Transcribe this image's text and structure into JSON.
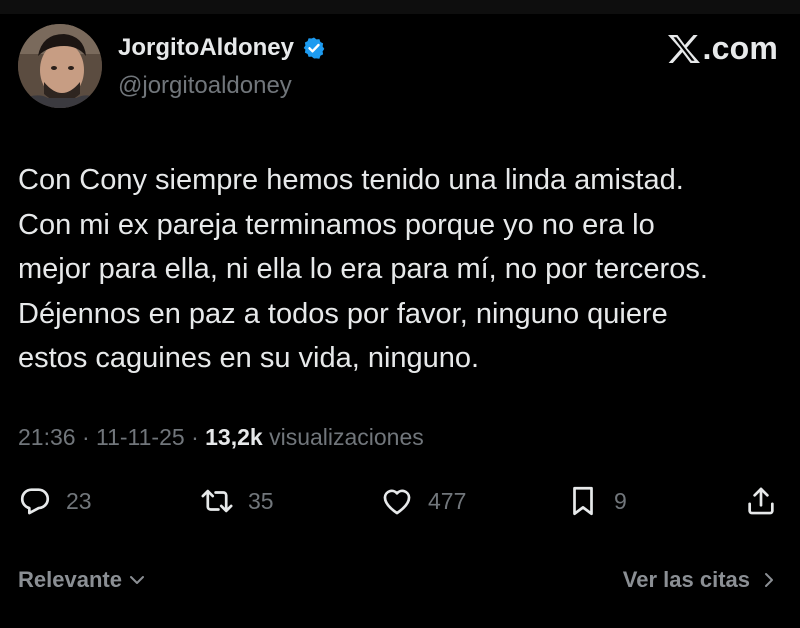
{
  "author": {
    "display_name": "JorgitoAldoney",
    "handle": "@jorgitoaldoney",
    "verified": true
  },
  "brand": {
    "text": ".com"
  },
  "tweet": {
    "lines": [
      "Con Cony siempre hemos tenido una linda amistad.",
      "Con mi ex pareja terminamos porque yo no era lo",
      "mejor para ella, ni ella lo era para mí, no por terceros.",
      "Déjennos en paz a todos por favor, ninguno quiere",
      "estos caguines en su vida, ninguno."
    ]
  },
  "meta": {
    "time": "21:36",
    "separator": "·",
    "date": "11-11-25",
    "views": "13,2k",
    "views_label": "visualizaciones"
  },
  "actions": {
    "replies": "23",
    "reposts": "35",
    "likes": "477",
    "bookmarks": "9"
  },
  "footer": {
    "sort_label": "Relevante",
    "quotes_link": "Ver las citas"
  },
  "colors": {
    "background": "#000000",
    "text": "#e7e9ea",
    "muted": "#71767b",
    "verified": "#1d9bf0"
  }
}
